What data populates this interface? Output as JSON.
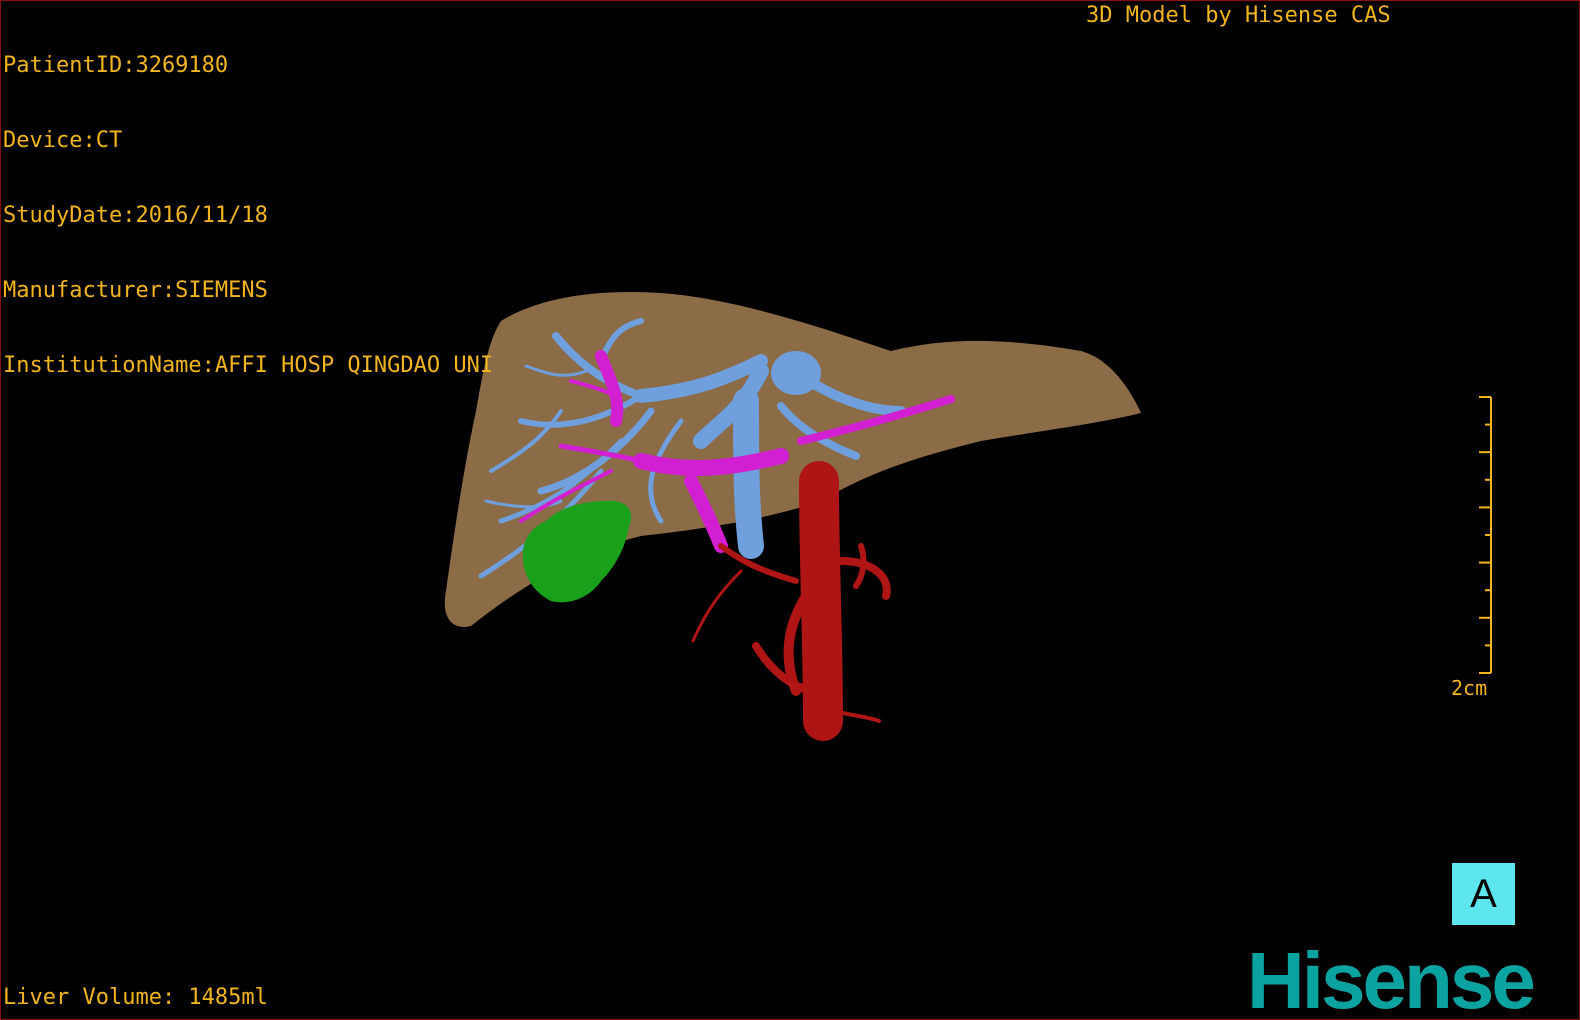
{
  "overlay": {
    "patient_id": "PatientID:3269180",
    "device": "Device:CT",
    "study_date": "StudyDate:2016/11/18",
    "manufacturer": "Manufacturer:SIEMENS",
    "institution": "InstitutionName:AFFI HOSP QINGDAO UNI",
    "credit": "3D Model by Hisense CAS",
    "liver_volume": "Liver Volume: 1485ml"
  },
  "scale_bar": {
    "label": "2cm"
  },
  "orientation": {
    "label": "A"
  },
  "logo": {
    "text": "Hisense"
  },
  "colors": {
    "text": "#f2b51e",
    "liver": "#8c6b47",
    "portal_vein": "#6f9fdc",
    "hepatic_vein": "#d21fd2",
    "artery_aorta": "#b01515",
    "gallbladder": "#1aa01a",
    "orientation_bg": "#5ee6ee",
    "logo": "#0aa3a0"
  }
}
